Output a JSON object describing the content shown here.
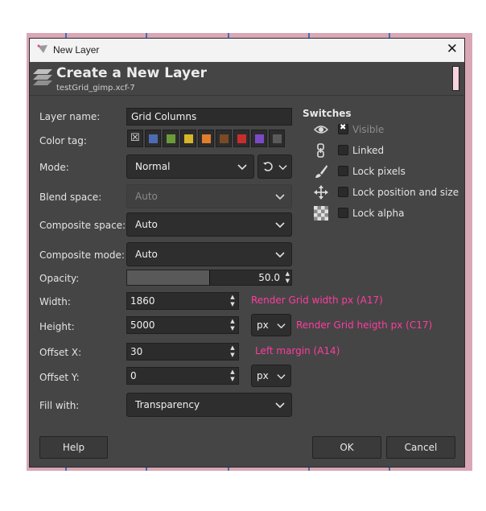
{
  "window": {
    "title": "New Layer",
    "close_glyph": "✕"
  },
  "header": {
    "title": "Create a New Layer",
    "subtitle": "testGrid_gimp.xcf-7"
  },
  "form": {
    "layer_name_label": "Layer name:",
    "layer_name_value": "Grid Columns",
    "color_tag_label": "Color tag:",
    "color_tags": [
      {
        "name": "none",
        "color": ""
      },
      {
        "name": "blue",
        "color": "#4d6bb3"
      },
      {
        "name": "green",
        "color": "#6a9a3a"
      },
      {
        "name": "yellow",
        "color": "#d7b52a"
      },
      {
        "name": "orange",
        "color": "#e07e2a"
      },
      {
        "name": "brown",
        "color": "#7a4a27"
      },
      {
        "name": "red",
        "color": "#c62e2e"
      },
      {
        "name": "violet",
        "color": "#7a4ac4"
      },
      {
        "name": "gray",
        "color": "#5a5a5a"
      }
    ],
    "mode_label": "Mode:",
    "mode_value": "Normal",
    "blend_space_label": "Blend space:",
    "blend_space_value": "Auto",
    "composite_space_label": "Composite space:",
    "composite_space_value": "Auto",
    "composite_mode_label": "Composite mode:",
    "composite_mode_value": "Auto",
    "opacity_label": "Opacity:",
    "opacity_value": "50.0",
    "opacity_fraction": 0.5,
    "width_label": "Width:",
    "width_value": "1860",
    "width_note": "Render Grid width px (A17)",
    "height_label": "Height:",
    "height_value": "5000",
    "height_unit": "px",
    "height_note": "Render Grid heigth px (C17)",
    "offset_x_label": "Offset X:",
    "offset_x_value": "30",
    "offset_x_note": "Left margin (A14)",
    "offset_y_label": "Offset Y:",
    "offset_y_value": "0",
    "offset_y_unit": "px",
    "fill_label": "Fill with:",
    "fill_value": "Transparency"
  },
  "switches": {
    "title": "Switches",
    "items": [
      {
        "icon": "eye-icon",
        "label": "Visible",
        "checked": true
      },
      {
        "icon": "chain-icon",
        "label": "Linked",
        "checked": false
      },
      {
        "icon": "paintbrush-icon",
        "label": "Lock pixels",
        "checked": false
      },
      {
        "icon": "move-arrows-icon",
        "label": "Lock position and size",
        "checked": false
      },
      {
        "icon": "checkerboard-icon",
        "label": "Lock alpha",
        "checked": false
      }
    ]
  },
  "buttons": {
    "help": "Help",
    "ok": "OK",
    "cancel": "Cancel"
  },
  "colors": {
    "note": "#ff3ca0",
    "dialog_bg": "#454545"
  }
}
